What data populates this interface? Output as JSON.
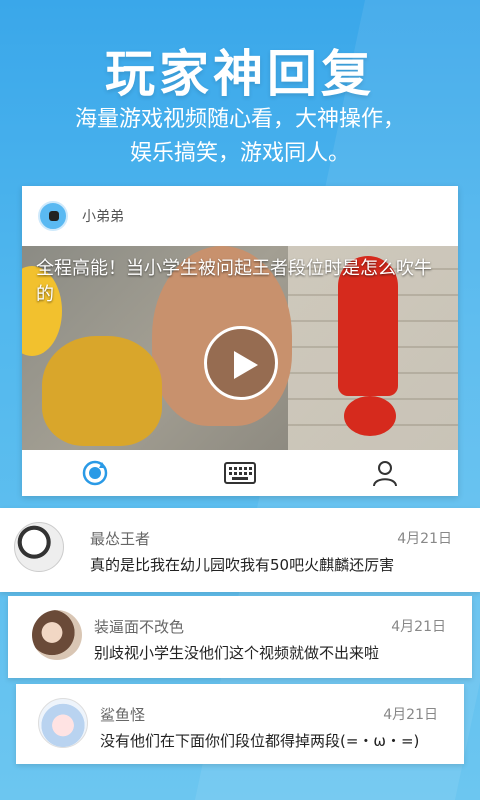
{
  "header": {
    "headline": "玩家神回复",
    "subline_1": "海量游戏视频随心看，大神操作，",
    "subline_2": "娱乐搞笑，游戏同人。"
  },
  "post": {
    "username": "小弟弟",
    "video_title": "全程高能！当小学生被问起王者段位时是怎么吹牛的",
    "toolbar_icons": [
      "refresh-icon",
      "keyboard-icon",
      "user-icon"
    ]
  },
  "comments": [
    {
      "name": "最怂王者",
      "date": "4月21日",
      "text": "真的是比我在幼儿园吹我有50吧火麒麟还厉害"
    },
    {
      "name": "装逼面不改色",
      "date": "4月21日",
      "text": "别歧视小学生没他们这个视频就做不出来啦"
    },
    {
      "name": "鲨鱼怪",
      "date": "4月21日",
      "text": "没有他们在下面你们段位都得掉两段(=・ω・=)"
    }
  ],
  "colors": {
    "background": "#4fb4ec",
    "card": "#ffffff",
    "accent": "#2a9ae6"
  }
}
